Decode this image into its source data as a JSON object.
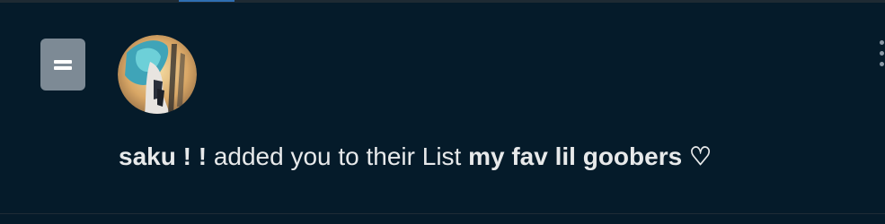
{
  "notification": {
    "user_name": "saku ! !",
    "action_text": "added you to their List",
    "list_name": "my fav lil goobers ♡",
    "type_icon": "list-icon",
    "avatar_icon": "avatar",
    "menu_icon": "more-icon"
  },
  "colors": {
    "background": "#051B2A",
    "text": "#E7E9EA",
    "icon_gray": "#7D8A95",
    "accent": "#2F6FB2"
  }
}
